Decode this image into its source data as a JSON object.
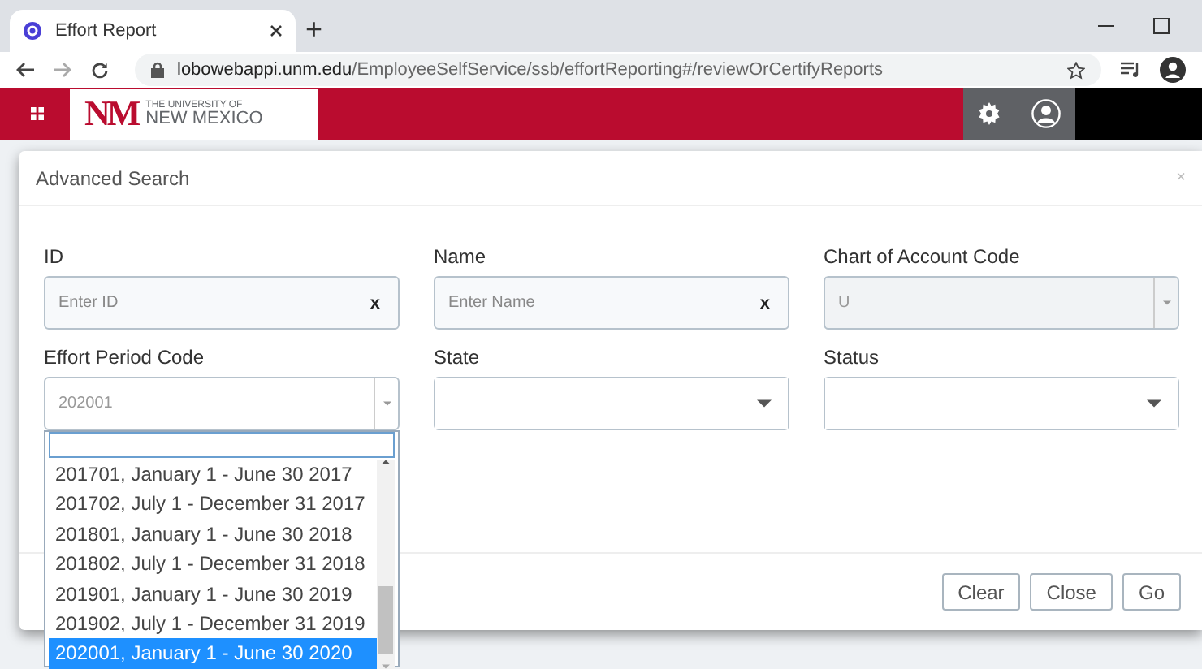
{
  "browser": {
    "tab": {
      "title": "Effort Report"
    },
    "new_tab": "+",
    "url_host": "lobowebappi.unm.edu",
    "url_path": "/EmployeeSelfService/ssb/effortReporting#/reviewOrCertifyReports"
  },
  "header": {
    "logo": {
      "mark": "NM",
      "line1": "THE UNIVERSITY OF",
      "line2": "NEW MEXICO"
    }
  },
  "dialog": {
    "title": "Advanced Search",
    "close": "×",
    "fields": [
      {
        "label": "ID",
        "kind": "text",
        "placeholder": "Enter ID",
        "clear": "x"
      },
      {
        "label": "Name",
        "kind": "text",
        "placeholder": "Enter Name",
        "clear": "x"
      },
      {
        "label": "Chart of Account Code",
        "kind": "select",
        "value": "U",
        "disabled": true
      },
      {
        "label": "Effort Period Code",
        "kind": "select",
        "value": "202001",
        "disabled": false,
        "options": [
          {
            "text": "201701, January 1 - June 30 2017",
            "selected": false
          },
          {
            "text": "201702, July 1 - December 31 2017",
            "selected": false
          },
          {
            "text": "201801, January 1 - June 30 2018",
            "selected": false
          },
          {
            "text": "201802, July 1 - December 31 2018",
            "selected": false
          },
          {
            "text": "201901, January 1 - June 30 2019",
            "selected": false
          },
          {
            "text": "201902, July 1 - December 31 2019",
            "selected": false
          },
          {
            "text": "202001, January 1 - June 30 2020",
            "selected": true
          }
        ]
      },
      {
        "label": "State",
        "kind": "dropdown"
      },
      {
        "label": "Status",
        "kind": "dropdown"
      }
    ],
    "buttons": [
      "Clear",
      "Close",
      "Go"
    ]
  }
}
